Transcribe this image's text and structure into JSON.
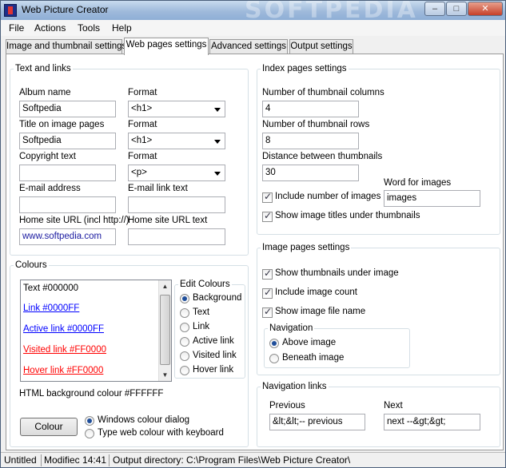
{
  "window": {
    "title": "Web Picture Creator",
    "watermark": "SOFTPEDIA"
  },
  "menu": [
    "File",
    "Actions",
    "Tools",
    "Help"
  ],
  "tabs": [
    "Image and thumbnail settings",
    "Web pages settings",
    "Advanced settings",
    "Output settings"
  ],
  "active_tab": "Web pages settings",
  "text_links": {
    "legend": "Text and links",
    "album_name_label": "Album name",
    "album_name_value": "Softpedia",
    "format_label_1": "Format",
    "format_value_1": "<h1>",
    "title_label": "Title on image pages",
    "title_value": "Softpedia",
    "format_label_2": "Format",
    "format_value_2": "<h1>",
    "copyright_label": "Copyright text",
    "copyright_value": "",
    "format_label_3": "Format",
    "format_value_3": "<p>",
    "email_label": "E-mail address",
    "email_value": "",
    "email_link_label": "E-mail link text",
    "email_link_value": "",
    "home_url_label": "Home site URL (incl http://)",
    "home_url_value": "www.softpedia.com",
    "home_url_text_label": "Home site URL text",
    "home_url_text_value": ""
  },
  "colours": {
    "legend": "Colours",
    "list": [
      {
        "text": "Text #000000",
        "color": "#000000"
      },
      {
        "text": "Link #0000FF",
        "color": "#0000FF"
      },
      {
        "text": "Active link #0000FF",
        "color": "#0000FF"
      },
      {
        "text": "Visited link #FF0000",
        "color": "#FF0000"
      },
      {
        "text": "Hover link #FF0000",
        "color": "#FF0000"
      }
    ],
    "edit_legend": "Edit Colours",
    "edit_options": [
      "Background",
      "Text",
      "Link",
      "Active link",
      "Visited link",
      "Hover link"
    ],
    "edit_selected": "Background",
    "background_text": "HTML background colour #FFFFFF",
    "colour_button": "Colour",
    "dialog_option_1": "Windows colour dialog",
    "dialog_option_2": "Type web colour with keyboard",
    "dialog_selected": "Windows colour dialog"
  },
  "index_pages": {
    "legend": "Index pages settings",
    "columns_label": "Number of thumbnail columns",
    "columns_value": "4",
    "rows_label": "Number of thumbnail rows",
    "rows_value": "8",
    "distance_label": "Distance between thumbnails",
    "distance_value": "30",
    "word_label": "Word for images",
    "word_value": "images",
    "include_number_label": "Include number of images",
    "include_number_checked": true,
    "show_titles_label": "Show image titles under thumbnails",
    "show_titles_checked": true
  },
  "image_pages": {
    "legend": "Image pages settings",
    "show_thumbs_label": "Show thumbnails under image",
    "include_count_label": "Include image count",
    "show_filename_label": "Show image file name",
    "navigation_legend": "Navigation",
    "above_label": "Above image",
    "beneath_label": "Beneath image",
    "navigation_selected": "Above image"
  },
  "nav_links": {
    "legend": "Navigation links",
    "previous_label": "Previous",
    "previous_value": "&lt;&lt;-- previous",
    "next_label": "Next",
    "next_value": "next --&gt;&gt;"
  },
  "status": {
    "doc": "Untitled",
    "modified": "Modifiec 14:41",
    "output": "Output directory: C:\\Program Files\\Web Picture Creator\\"
  }
}
